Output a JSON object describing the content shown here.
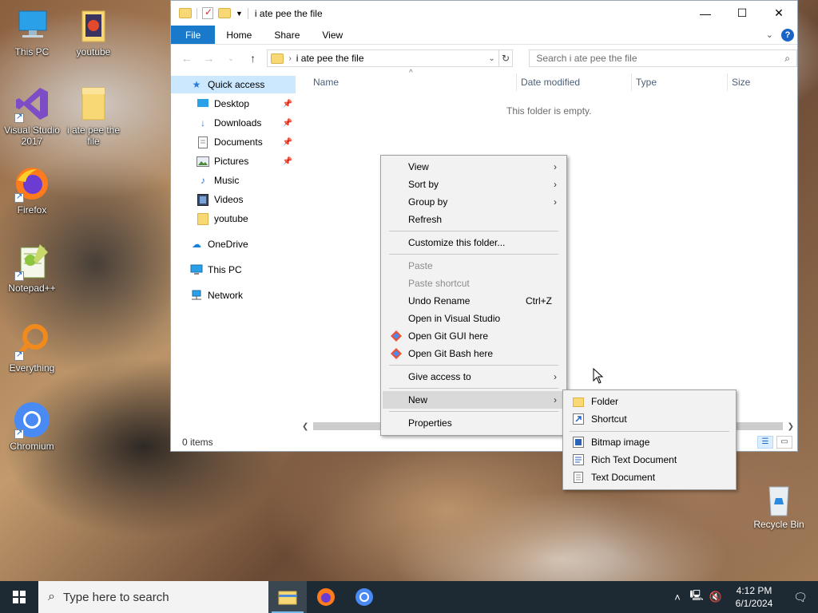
{
  "desktop": {
    "icons": [
      {
        "label": "This PC"
      },
      {
        "label": "youtube"
      },
      {
        "label": "Visual Studio 2017"
      },
      {
        "label": "i ate pee the file"
      },
      {
        "label": "Firefox"
      },
      {
        "label": "Notepad++"
      },
      {
        "label": "Everything"
      },
      {
        "label": "Chromium"
      }
    ],
    "recycle_bin": "Recycle Bin"
  },
  "explorer": {
    "title": "i ate pee the file",
    "ribbon_tabs": [
      "File",
      "Home",
      "Share",
      "View"
    ],
    "help": "?",
    "address": "i ate pee the file",
    "search_placeholder": "Search i ate pee the file",
    "nav": {
      "quick_access": "Quick access",
      "items": [
        "Desktop",
        "Downloads",
        "Documents",
        "Pictures",
        "Music",
        "Videos",
        "youtube"
      ],
      "onedrive": "OneDrive",
      "this_pc": "This PC",
      "network": "Network"
    },
    "columns": [
      "Name",
      "Date modified",
      "Type",
      "Size"
    ],
    "empty_message": "This folder is empty.",
    "status": "0 items"
  },
  "context_menu": {
    "items": [
      {
        "label": "View"
      },
      {
        "label": "Sort by"
      },
      {
        "label": "Group by"
      },
      {
        "label": "Refresh"
      },
      {
        "label": "Customize this folder..."
      },
      {
        "label": "Paste"
      },
      {
        "label": "Paste shortcut"
      },
      {
        "label": "Undo Rename",
        "shortcut": "Ctrl+Z"
      },
      {
        "label": "Open in Visual Studio"
      },
      {
        "label": "Open Git GUI here"
      },
      {
        "label": "Open Git Bash here"
      },
      {
        "label": "Give access to"
      },
      {
        "label": "New"
      },
      {
        "label": "Properties"
      }
    ]
  },
  "new_submenu": {
    "items": [
      "Folder",
      "Shortcut",
      "Bitmap image",
      "Rich Text Document",
      "Text Document"
    ]
  },
  "taskbar": {
    "search_placeholder": "Type here to search",
    "time": "4:12 PM",
    "date": "6/1/2024"
  },
  "colors": {
    "accent": "#1979ca",
    "selection": "#cce8ff",
    "menu_bg": "#f2f2f2",
    "taskbar": "#1e2a33"
  }
}
